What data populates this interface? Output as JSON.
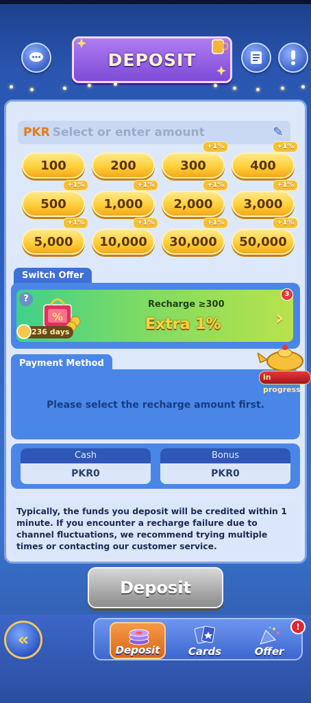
{
  "header": {
    "title": "DEPOSIT",
    "icons": [
      "chat-icon",
      "records-icon",
      "info-icon"
    ]
  },
  "amount_input": {
    "currency": "PKR",
    "placeholder": "Select or enter amount"
  },
  "amount_options": [
    {
      "label": "100",
      "bonus": ""
    },
    {
      "label": "200",
      "bonus": ""
    },
    {
      "label": "300",
      "bonus": "+1%"
    },
    {
      "label": "400",
      "bonus": "+1%"
    },
    {
      "label": "500",
      "bonus": "+1%"
    },
    {
      "label": "1,000",
      "bonus": "+1%"
    },
    {
      "label": "2,000",
      "bonus": "+1%"
    },
    {
      "label": "3,000",
      "bonus": "+1%"
    },
    {
      "label": "5,000",
      "bonus": "+1%"
    },
    {
      "label": "10,000",
      "bonus": "+1%"
    },
    {
      "label": "30,000",
      "bonus": "+1%"
    },
    {
      "label": "50,000",
      "bonus": "+1%"
    }
  ],
  "switch_offer": {
    "tab_label": "Switch Offer",
    "recharge_text": "Recharge ≥300",
    "extra_text": "Extra  1%",
    "days_text": "236 days",
    "count_badge": "3"
  },
  "payment": {
    "tab_label": "Payment Method",
    "message": "Please select the recharge amount first.",
    "status_badge": "in progress"
  },
  "balances": {
    "cash_label": "Cash",
    "cash_value": "PKR0",
    "bonus_label": "Bonus",
    "bonus_value": "PKR0"
  },
  "notice": "Typically, the funds you deposit will be credited within 1 minute. If you encounter a recharge failure due to channel fluctuations, we recommend trying multiple times or contacting our customer service.",
  "deposit_button": "Deposit",
  "bottom_nav": {
    "items": [
      {
        "label": "Deposit",
        "icon": "chips-icon",
        "active": true
      },
      {
        "label": "Cards",
        "icon": "cards-icon",
        "active": false
      },
      {
        "label": "Offer",
        "icon": "party-popper-icon",
        "active": false
      }
    ],
    "offer_badge": "!"
  },
  "colors": {
    "accent": "#ffcf3a",
    "panel": "#dde8fb",
    "primary": "#3e70d6",
    "alert": "#e2262f"
  }
}
